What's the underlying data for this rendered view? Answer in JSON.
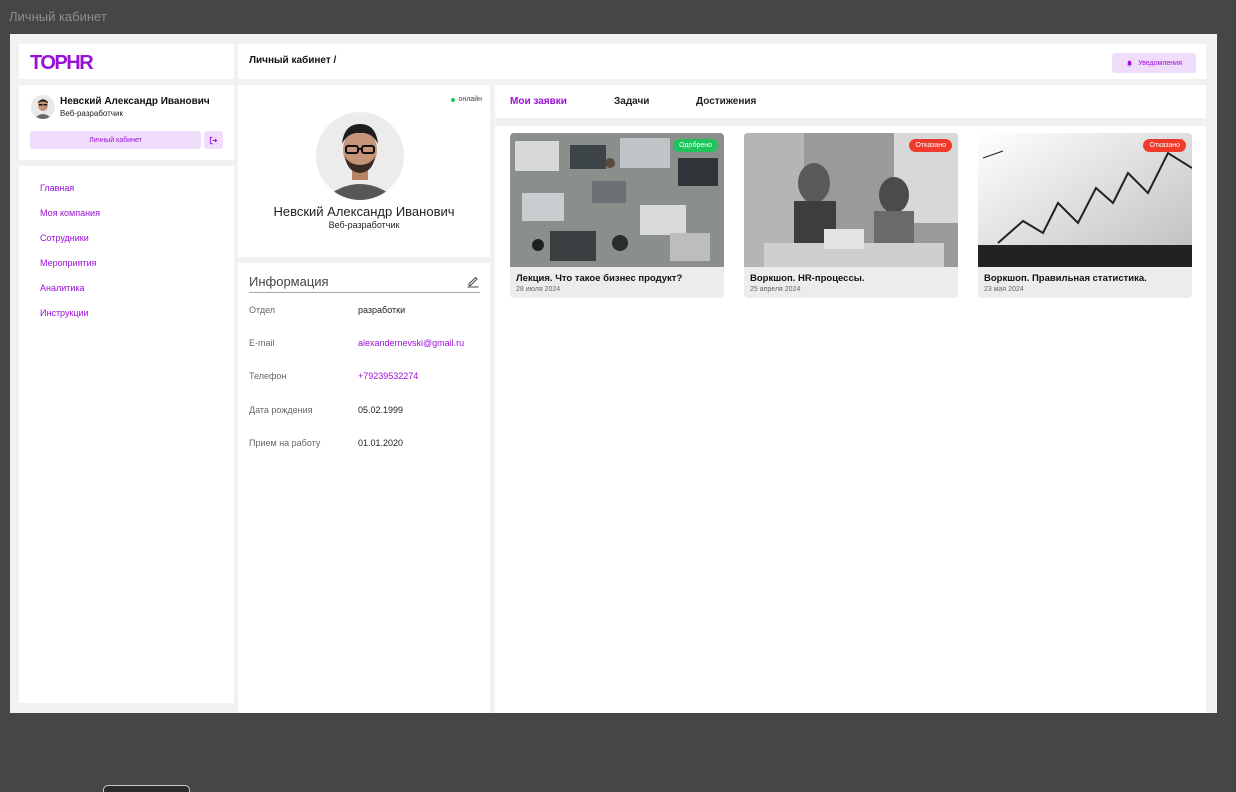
{
  "window": {
    "title": "Личный кабинет"
  },
  "logo": {
    "text": "TOPHR"
  },
  "header": {
    "breadcrumb": "Личный кабинет /",
    "notifications_label": "Уведомления",
    "notifications_icon": "bell-icon"
  },
  "user": {
    "name": "Невский Александр Иванович",
    "role": "Веб-разработчик",
    "cabinet_label": "Личный кабинет",
    "logout_icon": "logout-icon"
  },
  "nav": {
    "items": [
      {
        "label": "Главная"
      },
      {
        "label": "Моя компания"
      },
      {
        "label": "Сотрудники"
      },
      {
        "label": "Мероприятия"
      },
      {
        "label": "Аналитика"
      },
      {
        "label": "Инструкции"
      }
    ]
  },
  "profile": {
    "status": "онлайн",
    "name": "Невский Александр Иванович",
    "role": "Веб-разработчик"
  },
  "info": {
    "title": "Информация",
    "rows": [
      {
        "label": "Отдел",
        "value": "разработки"
      },
      {
        "label": "E-mail",
        "value": "alexandernevski@gmail.ru"
      },
      {
        "label": "Телефон",
        "value": "+79239532274"
      },
      {
        "label": "Дата рождения",
        "value": "05.02.1999"
      },
      {
        "label": "Прием на работу",
        "value": "01.01.2020"
      }
    ]
  },
  "tabs": [
    {
      "label": "Мои заявки",
      "active": true
    },
    {
      "label": "Задачи",
      "active": false
    },
    {
      "label": "Достижения",
      "active": false
    }
  ],
  "cards": [
    {
      "title": "Лекция. Что такое бизнес продукт?",
      "date": "28 июля 2024",
      "status": "Одобрено",
      "status_color": "#1ec45c"
    },
    {
      "title": "Воркшоп. HR-процессы.",
      "date": "25 апреля 2024",
      "status": "Отказано",
      "status_color": "#f03a2c"
    },
    {
      "title": "Воркшоп. Правильная статистика.",
      "date": "23 мая 2024",
      "status": "Отказано",
      "status_color": "#f03a2c"
    }
  ],
  "colors": {
    "accent": "#9b10d6",
    "accent_light": "#f0dcfb",
    "approved": "#1ec45c",
    "rejected": "#f03a2c"
  }
}
